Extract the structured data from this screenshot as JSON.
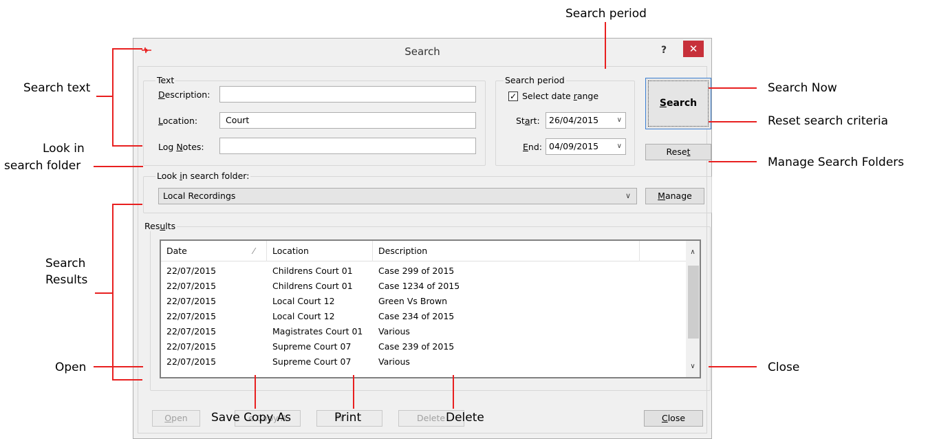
{
  "window": {
    "title": "Search",
    "help_label": "?",
    "close_glyph": "✕"
  },
  "text_group": {
    "title": "Text",
    "description": {
      "label_pre": "",
      "label_acc": "D",
      "label_post": "escription:",
      "value": ""
    },
    "location": {
      "label_pre": "",
      "label_acc": "L",
      "label_post": "ocation:",
      "value": "Court"
    },
    "log_notes": {
      "label_pre": "Log ",
      "label_acc": "N",
      "label_post": "otes:",
      "value": ""
    }
  },
  "period_group": {
    "title": "Search period",
    "checkbox_label_pre": "Select date ",
    "checkbox_label_acc": "r",
    "checkbox_label_post": "ange",
    "checked": true,
    "start": {
      "label_pre": "St",
      "label_acc": "a",
      "label_post": "rt:",
      "value": "26/04/2015"
    },
    "end": {
      "label_pre": "",
      "label_acc": "E",
      "label_post": "nd:",
      "value": "04/09/2015"
    }
  },
  "buttons": {
    "search": {
      "acc": "S",
      "post": "earch"
    },
    "reset": {
      "pre": "Rese",
      "acc": "t",
      "post": ""
    },
    "manage": {
      "pre": "",
      "acc": "M",
      "post": "anage"
    },
    "open": {
      "pre": "",
      "acc": "O",
      "post": "pen"
    },
    "save_copy_partial": "e Copy A",
    "print_partial": "Pr",
    "delete_partial": "Delete",
    "close": {
      "pre": "",
      "acc": "C",
      "post": "lose"
    }
  },
  "folder_group": {
    "title_pre": "Look ",
    "title_acc": "i",
    "title_post": "n search folder:",
    "selected": "Local Recordings"
  },
  "results_group": {
    "title_pre": "Res",
    "title_acc": "u",
    "title_post": "lts",
    "columns": [
      "Date",
      "Location",
      "Description"
    ],
    "rows": [
      {
        "date": "22/07/2015",
        "location": "Childrens Court 01",
        "description": "Case 299 of 2015"
      },
      {
        "date": "22/07/2015",
        "location": "Childrens Court 01",
        "description": "Case 1234 of 2015"
      },
      {
        "date": "22/07/2015",
        "location": "Local Court 12",
        "description": "Green Vs Brown"
      },
      {
        "date": "22/07/2015",
        "location": "Local Court 12",
        "description": "Case 234 of 2015"
      },
      {
        "date": "22/07/2015",
        "location": "Magistrates Court 01",
        "description": "Various"
      },
      {
        "date": "22/07/2015",
        "location": "Supreme Court 07",
        "description": "Case 239 of 2015"
      },
      {
        "date": "22/07/2015",
        "location": "Supreme Court 07",
        "description": "Various"
      }
    ]
  },
  "callouts": {
    "search_text": "Search text",
    "look_in_line1": "Look in",
    "look_in_line2": "search folder",
    "search_results_line1": "Search",
    "search_results_line2": "Results",
    "open": "Open",
    "search_period": "Search period",
    "search_now": "Search Now",
    "reset_criteria": "Reset search criteria",
    "manage_folders": "Manage Search Folders",
    "close": "Close",
    "save_copy_as": "Save Copy As",
    "print": "Print",
    "delete": "Delete"
  },
  "colors": {
    "callout_line": "#e81f1f",
    "close_button_bg": "#c7303a",
    "dialog_bg": "#f0f0f0"
  }
}
